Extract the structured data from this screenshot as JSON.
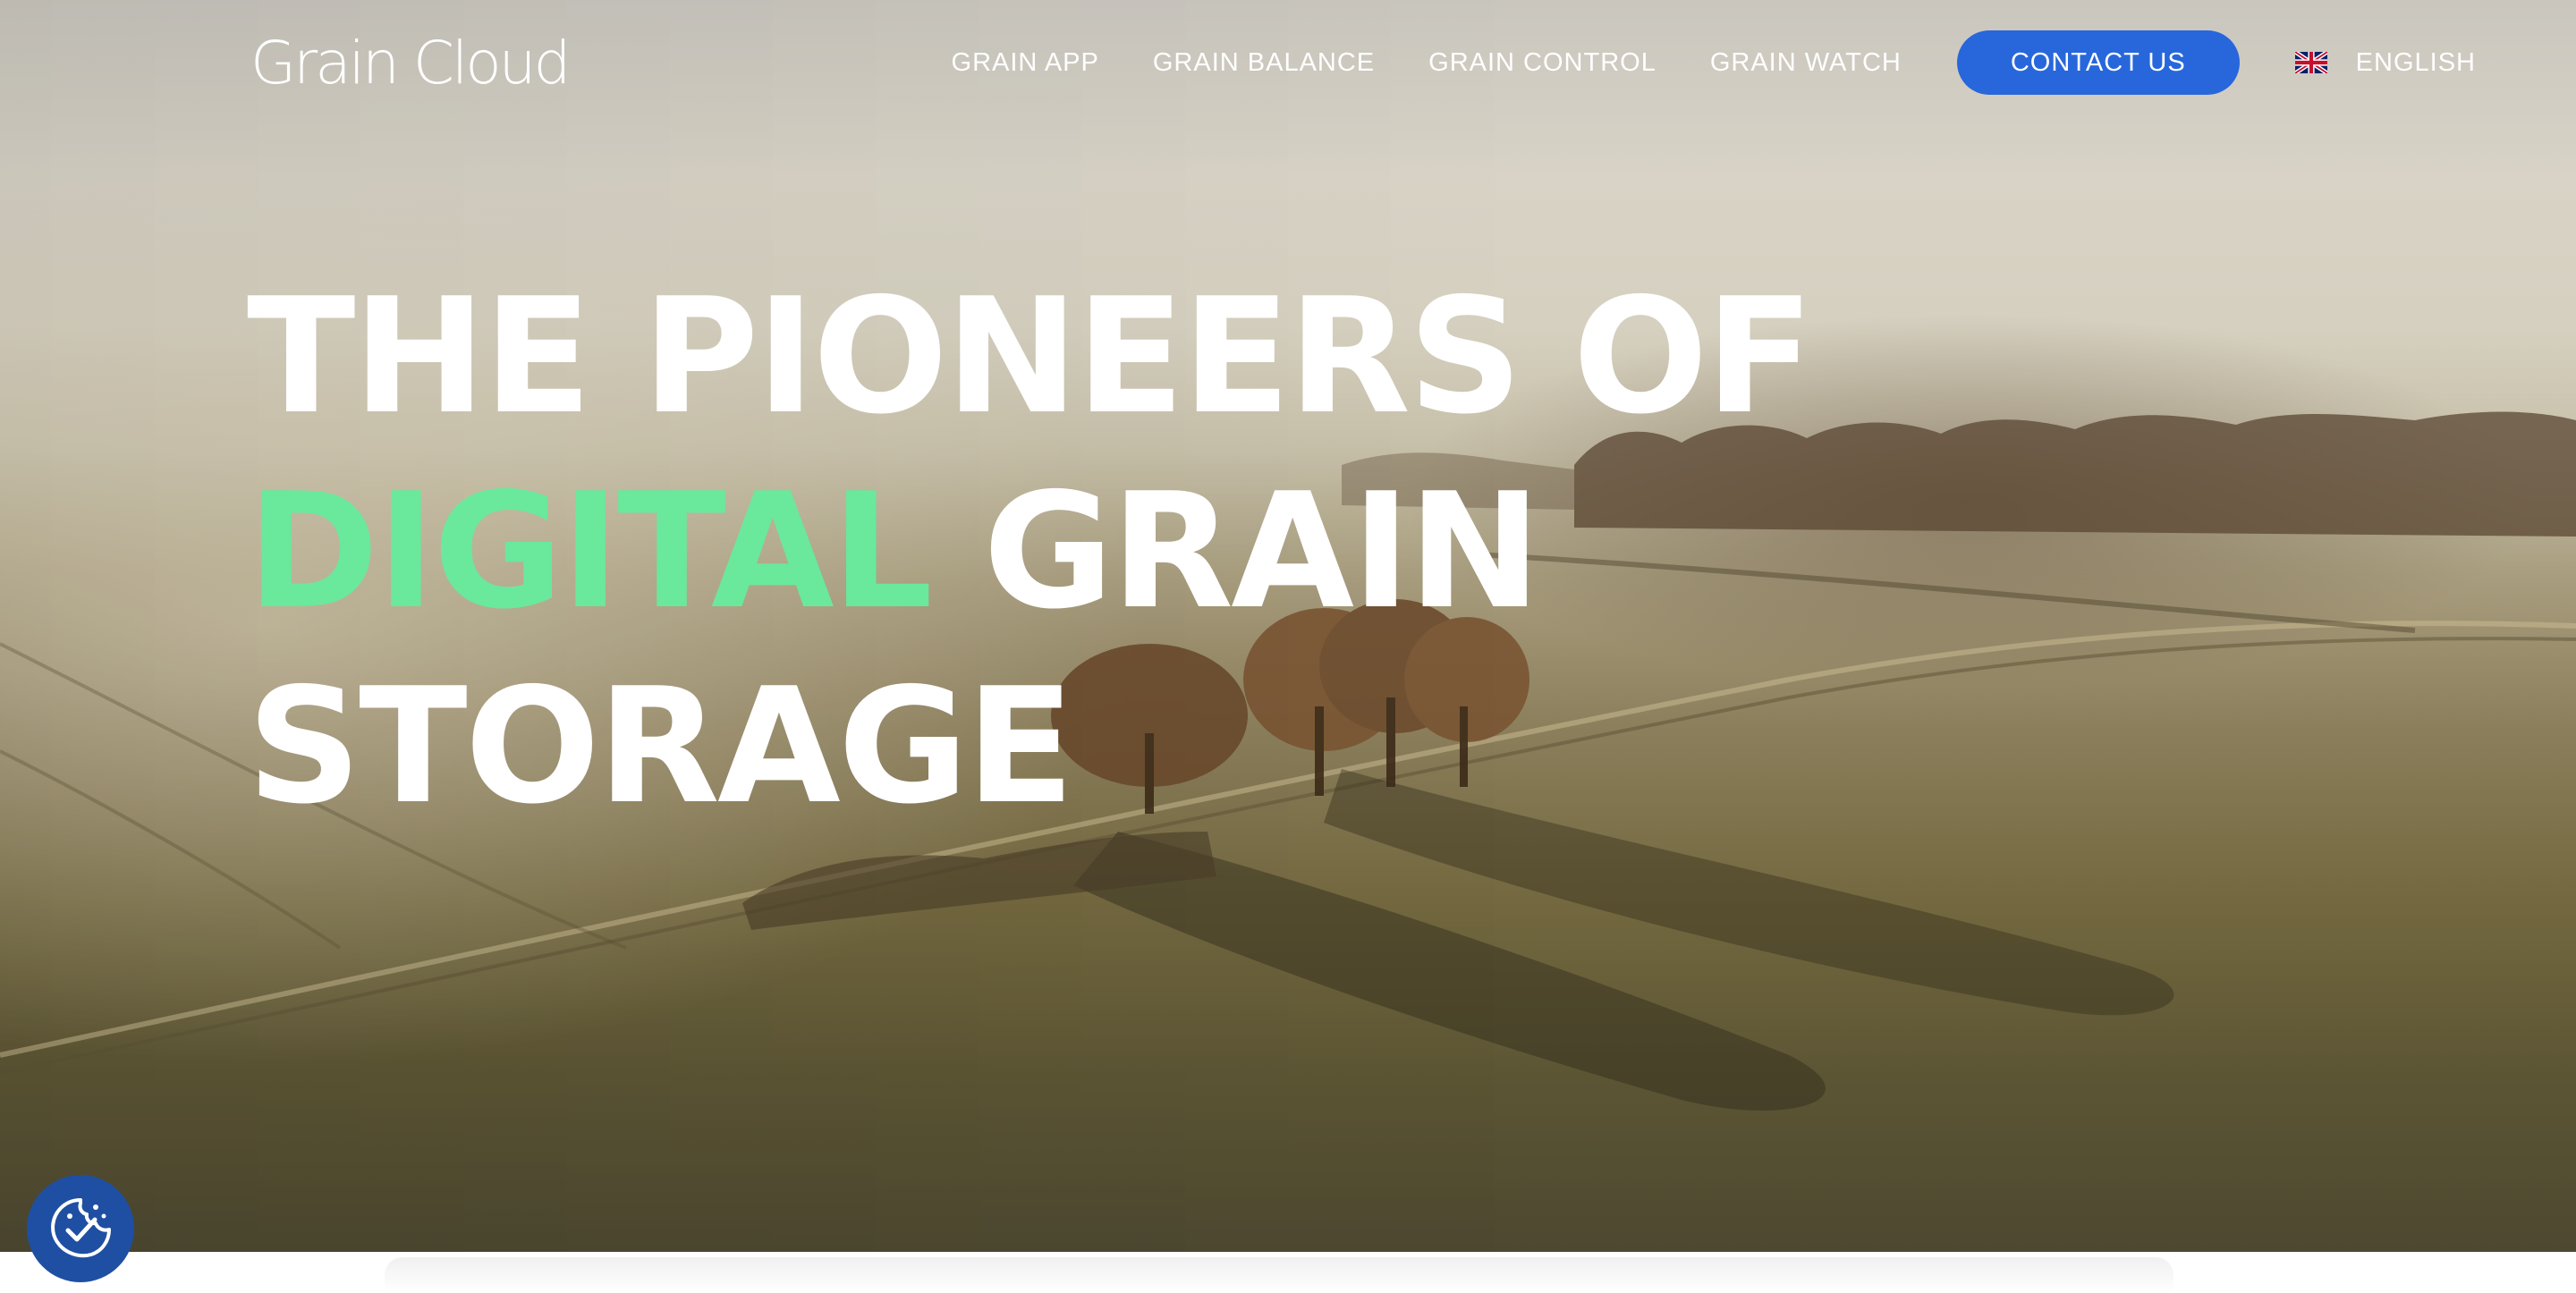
{
  "brand": {
    "logo_text": "Grain Cloud"
  },
  "nav": {
    "links": [
      {
        "label": "GRAIN APP"
      },
      {
        "label": "GRAIN BALANCE"
      },
      {
        "label": "GRAIN CONTROL"
      },
      {
        "label": "GRAIN WATCH"
      }
    ],
    "contact_label": "CONTACT US",
    "language": {
      "label": "ENGLISH",
      "flag_icon": "uk-flag-icon"
    }
  },
  "hero": {
    "line1": "THE PIONEERS OF",
    "line2_accent": "DIGITAL",
    "line2_rest": " GRAIN",
    "line3": "STORAGE",
    "accent_color": "#6ae89b"
  },
  "cookie_button": {
    "icon": "cookie-consent-icon"
  },
  "colors": {
    "primary_button": "#2767db",
    "cookie_button": "#1f4fa3",
    "accent": "#6ae89b"
  }
}
